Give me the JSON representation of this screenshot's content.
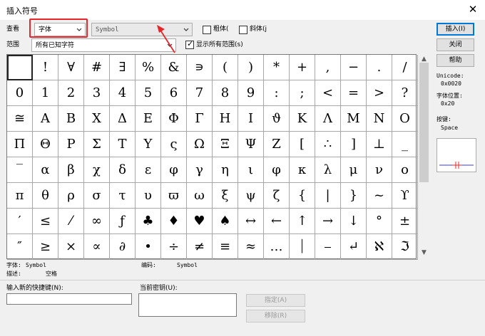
{
  "window": {
    "title": "插入符号",
    "close_glyph": "✕"
  },
  "view": {
    "label": "查看",
    "selected": "字体",
    "font_select_value": "Symbol",
    "bold_label": "粗体(",
    "italic_label": "斜体(j",
    "bold_checked": false,
    "italic_checked": false
  },
  "range": {
    "label": "范围",
    "select_value": "所有已知字符",
    "show_all_label": "显示所有范围(s)",
    "show_all_checked": true
  },
  "grid": {
    "selected_row": 0,
    "selected_col": 0,
    "rows": [
      [
        "",
        "!",
        "∀",
        "#",
        "∃",
        "%",
        "&",
        "∍",
        "(",
        ")",
        "*",
        "+",
        ",",
        "−",
        ".",
        "/"
      ],
      [
        "0",
        "1",
        "2",
        "3",
        "4",
        "5",
        "6",
        "7",
        "8",
        "9",
        ":",
        ";",
        "<",
        "=",
        ">",
        "?"
      ],
      [
        "≅",
        "Α",
        "Β",
        "Χ",
        "Δ",
        "Ε",
        "Φ",
        "Γ",
        "Η",
        "Ι",
        "ϑ",
        "Κ",
        "Λ",
        "Μ",
        "Ν",
        "Ο"
      ],
      [
        "Π",
        "Θ",
        "Ρ",
        "Σ",
        "Τ",
        "Υ",
        "ς",
        "Ω",
        "Ξ",
        "Ψ",
        "Ζ",
        "[",
        "∴",
        "]",
        "⊥",
        "_"
      ],
      [
        "‾",
        "α",
        "β",
        "χ",
        "δ",
        "ε",
        "φ",
        "γ",
        "η",
        "ι",
        "φ",
        "κ",
        "λ",
        "μ",
        "ν",
        "ο"
      ],
      [
        "π",
        "θ",
        "ρ",
        "σ",
        "τ",
        "υ",
        "ϖ",
        "ω",
        "ξ",
        "ψ",
        "ζ",
        "{",
        "|",
        "}",
        "~",
        "ϒ"
      ],
      [
        "′",
        "≤",
        "⁄",
        "∞",
        "ƒ",
        "♣",
        "♦",
        "♥",
        "♠",
        "↔",
        "←",
        "↑",
        "→",
        "↓",
        "°",
        "±"
      ],
      [
        "″",
        "≥",
        "×",
        "∝",
        "∂",
        "•",
        "÷",
        "≠",
        "≡",
        "≈",
        "…",
        "⏐",
        "⎯",
        "↵",
        "ℵ",
        "ℑ"
      ]
    ]
  },
  "buttons": {
    "insert": "插入(I)",
    "close": "关闭",
    "help": "帮助",
    "assign": "指定(A)",
    "remove": "移除(R)"
  },
  "info": {
    "unicode_label": "Unicode:",
    "unicode_value": "0x0020",
    "font_pos_label": "字体位置:",
    "font_pos_value": "0x20",
    "key_label": "按键:",
    "key_value": "Space"
  },
  "status": {
    "font_label": "字体:",
    "font_value": "Symbol",
    "encoding_label": "编码:",
    "encoding_value": "Symbol",
    "desc_label": "描述:",
    "desc_value": "空格"
  },
  "shortcut": {
    "new_label": "输入新的快捷键(N):",
    "new_value": "",
    "current_label": "当前密钥(U):",
    "current_value": ""
  },
  "annotation": {
    "color": "#e5262b"
  }
}
